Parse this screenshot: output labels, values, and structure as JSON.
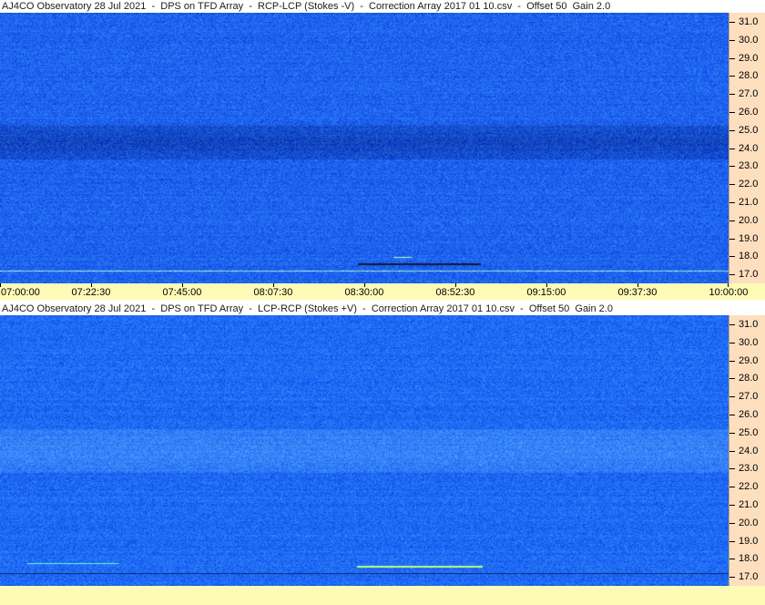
{
  "chart_data": [
    {
      "type": "heatmap",
      "title": "AJ4CO Observatory 28 Jul 2021  -  DPS on TFD Array  -  RCP-LCP (Stokes -V)  -  Correction Array 2017 01 10.csv  -  Offset 50  Gain 2.0",
      "x_tick_labels": [
        "07:00:00",
        "07:22:30",
        "07:45:00",
        "08:07:30",
        "08:30:00",
        "08:52:30",
        "09:15:00",
        "09:37:30",
        "10:00:00"
      ],
      "y_tick_labels": [
        "31.0",
        "30.0",
        "29.0",
        "28.0",
        "27.0",
        "26.0",
        "25.0",
        "24.0",
        "23.0",
        "22.0",
        "21.0",
        "20.0",
        "19.0",
        "18.0",
        "17.0"
      ],
      "ylim": [
        16.5,
        31.5
      ],
      "colors": {
        "base": "#1e63ee",
        "dark_band": "#1144c0"
      },
      "dark_bands": [
        [
          23.4,
          25.3
        ]
      ],
      "interference_lines": [
        17.2,
        17.6
      ]
    },
    {
      "type": "heatmap",
      "title": "AJ4CO Observatory 28 Jul 2021  -  DPS on TFD Array  -  LCP-RCP (Stokes +V)  -  Correction Array 2017 01 10.csv  -  Offset 50  Gain 2.0",
      "x_tick_labels": [],
      "y_tick_labels": [
        "31.0",
        "30.0",
        "29.0",
        "28.0",
        "27.0",
        "26.0",
        "25.0",
        "24.0",
        "23.0",
        "22.0",
        "21.0",
        "20.0",
        "19.0",
        "18.0",
        "17.0"
      ],
      "ylim": [
        16.5,
        31.5
      ],
      "colors": {
        "base": "#1f6af3",
        "light_band": "#3a86f8"
      },
      "light_bands": [
        [
          22.8,
          25.2
        ]
      ],
      "interference_lines": [
        17.2,
        17.6
      ]
    }
  ]
}
